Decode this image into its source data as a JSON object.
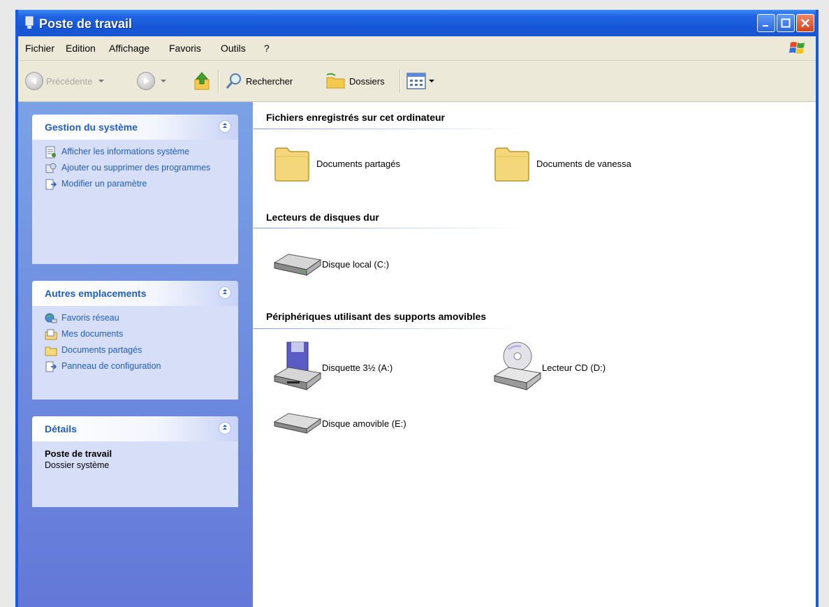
{
  "window": {
    "title": "Poste de travail"
  },
  "menubar": {
    "items": [
      "Fichier",
      "Edition",
      "Affichage",
      "Favoris",
      "Outils",
      "?"
    ]
  },
  "toolbar": {
    "back_label": "Précédente",
    "search_label": "Rechercher",
    "folders_label": "Dossiers"
  },
  "sidebar": {
    "panels": [
      {
        "title": "Gestion du système",
        "tasks": [
          {
            "label": "Afficher les informations système",
            "icon": "system-info-icon"
          },
          {
            "label": "Ajouter ou supprimer des programmes",
            "icon": "add-remove-programs-icon"
          },
          {
            "label": "Modifier un paramètre",
            "icon": "control-panel-icon"
          }
        ]
      },
      {
        "title": "Autres emplacements",
        "tasks": [
          {
            "label": "Favoris réseau",
            "icon": "network-icon"
          },
          {
            "label": "Mes documents",
            "icon": "my-documents-icon"
          },
          {
            "label": "Documents partagés",
            "icon": "folder-icon"
          },
          {
            "label": "Panneau de configuration",
            "icon": "control-panel-icon"
          }
        ]
      },
      {
        "title": "Détails",
        "name": "Poste de travail",
        "type": "Dossier système"
      }
    ]
  },
  "content": {
    "groups": [
      {
        "title": "Fichiers enregistrés sur cet ordinateur",
        "items": [
          {
            "label": "Documents partagés",
            "icon": "folder-icon"
          },
          {
            "label": "Documents de vanessa",
            "icon": "folder-icon"
          }
        ]
      },
      {
        "title": "Lecteurs de disques dur",
        "items": [
          {
            "label": "Disque local (C:)",
            "icon": "hard-drive-icon"
          }
        ]
      },
      {
        "title": "Périphériques utilisant des supports amovibles",
        "items": [
          {
            "label": "Disquette 3½ (A:)",
            "icon": "floppy-drive-icon"
          },
          {
            "label": "Lecteur CD (D:)",
            "icon": "cd-drive-icon"
          },
          {
            "label": "Disque amovible (E:)",
            "icon": "removable-disk-icon"
          }
        ]
      }
    ]
  },
  "colors": {
    "titlebar": "#1f63e3",
    "sidebar": "#6f8ddf",
    "link": "#215dc6",
    "folder": "#f5d97a"
  }
}
